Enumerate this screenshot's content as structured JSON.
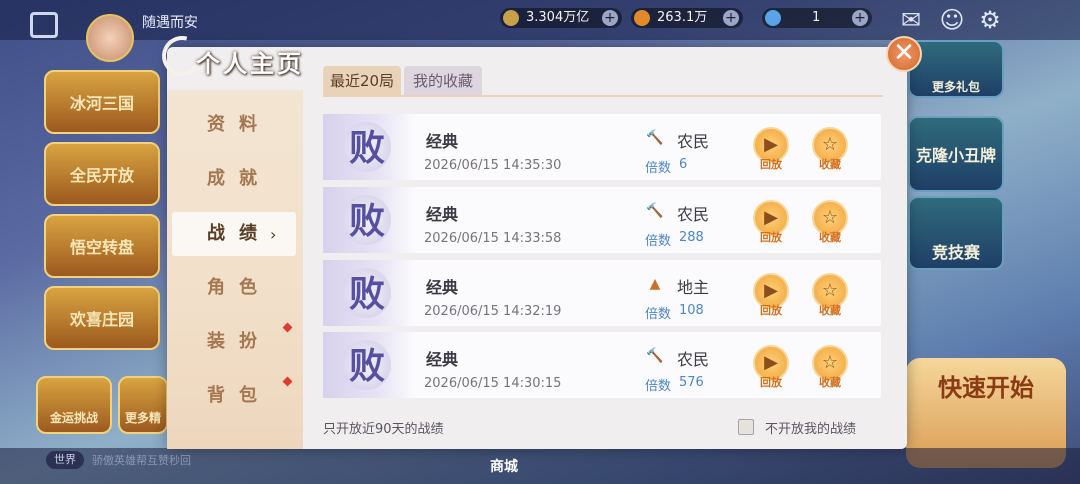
{
  "lobby": {
    "username": "随遇而安",
    "resources": [
      {
        "value": "3.304万亿",
        "icon": "gold-coin-icon",
        "color": "#c9a04a"
      },
      {
        "value": "263.1万",
        "icon": "bean-icon",
        "color": "#e08a2b"
      },
      {
        "value": "1",
        "icon": "diamond-icon",
        "color": "#5aa3e6"
      }
    ],
    "left_tiles": [
      "冰河三国",
      "全民开放",
      "悟空转盘",
      "欢喜庄园"
    ],
    "left_bottom": [
      "金运挑战",
      "更多精"
    ],
    "right_tiles": [
      "更多礼包",
      "克隆小丑牌",
      "竞技赛"
    ],
    "quick_start": "快速开始",
    "bottom_chip": "世界",
    "bottom_msg": "骄傲英雄帮互赞秒回",
    "bottom_nav": [
      "商城"
    ]
  },
  "dialog": {
    "title": "个人主页",
    "close_glyph": "✕",
    "sidebar": [
      {
        "label": "资料",
        "active": false,
        "dot": false
      },
      {
        "label": "成就",
        "active": false,
        "dot": false
      },
      {
        "label": "战绩",
        "active": true,
        "dot": false
      },
      {
        "label": "角色",
        "active": false,
        "dot": false
      },
      {
        "label": "装扮",
        "active": false,
        "dot": true
      },
      {
        "label": "背包",
        "active": false,
        "dot": true
      }
    ],
    "tabs": [
      {
        "label": "最近20局",
        "active": true
      },
      {
        "label": "我的收藏",
        "active": false
      }
    ],
    "records": [
      {
        "result": "败",
        "mode": "经典",
        "time": "2026/06/15  14:35:30",
        "role": "农民",
        "role_icon": "hammer-icon",
        "multiplier_label": "倍数",
        "multiplier": "6",
        "replay_label": "回放",
        "collect_label": "收藏"
      },
      {
        "result": "败",
        "mode": "经典",
        "time": "2026/06/15  14:33:58",
        "role": "农民",
        "role_icon": "hammer-icon",
        "multiplier_label": "倍数",
        "multiplier": "288",
        "replay_label": "回放",
        "collect_label": "收藏"
      },
      {
        "result": "败",
        "mode": "经典",
        "time": "2026/06/15  14:32:19",
        "role": "地主",
        "role_icon": "landlord-hat-icon",
        "multiplier_label": "倍数",
        "multiplier": "108",
        "replay_label": "回放",
        "collect_label": "收藏"
      },
      {
        "result": "败",
        "mode": "经典",
        "time": "2026/06/15  14:30:15",
        "role": "农民",
        "role_icon": "hammer-icon",
        "multiplier_label": "倍数",
        "multiplier": "576",
        "replay_label": "回放",
        "collect_label": "收藏"
      }
    ],
    "footer_note": "只开放近90天的战绩",
    "privacy_checkbox_label": "不开放我的战绩",
    "privacy_checked": false
  }
}
